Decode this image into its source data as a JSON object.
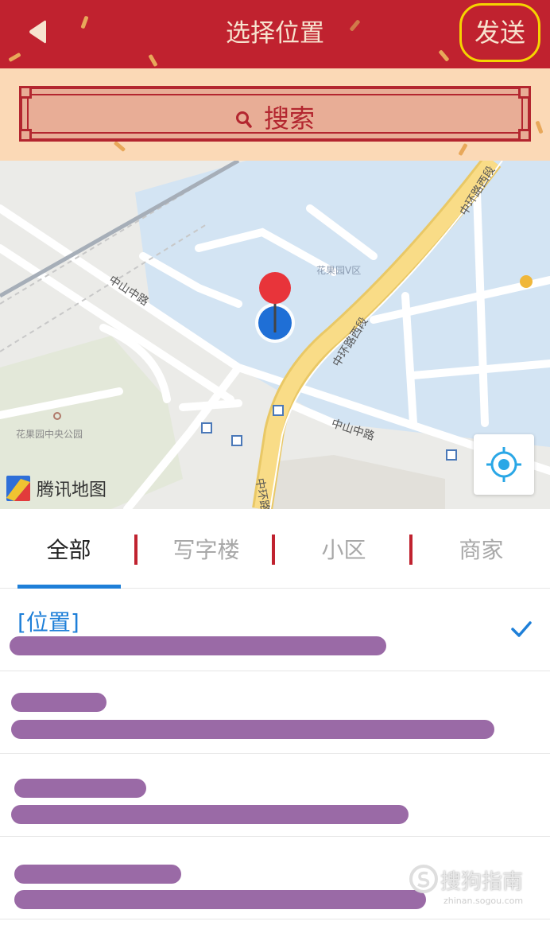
{
  "header": {
    "title": "选择位置",
    "send_label": "发送",
    "bg_color": "#c0222f",
    "highlight_color": "#f5d400"
  },
  "search": {
    "label": "搜索"
  },
  "map": {
    "provider_label": "腾讯地图",
    "road_labels": [
      "中环路西段",
      "中环路西段",
      "中山中路",
      "中山中路",
      "中环路"
    ],
    "place_labels": [
      "花果园V区",
      "花果园中央公园"
    ]
  },
  "tabs": [
    {
      "label": "全部",
      "active": true
    },
    {
      "label": "写字楼",
      "active": false
    },
    {
      "label": "小区",
      "active": false
    },
    {
      "label": "商家",
      "active": false
    }
  ],
  "results": [
    {
      "title": "[位置]",
      "selected": true
    },
    {
      "title": "",
      "selected": false
    },
    {
      "title": "",
      "selected": false
    },
    {
      "title": "",
      "selected": false
    }
  ],
  "watermark": {
    "text": "搜狗指南",
    "url": "zhinan.sogou.com"
  }
}
